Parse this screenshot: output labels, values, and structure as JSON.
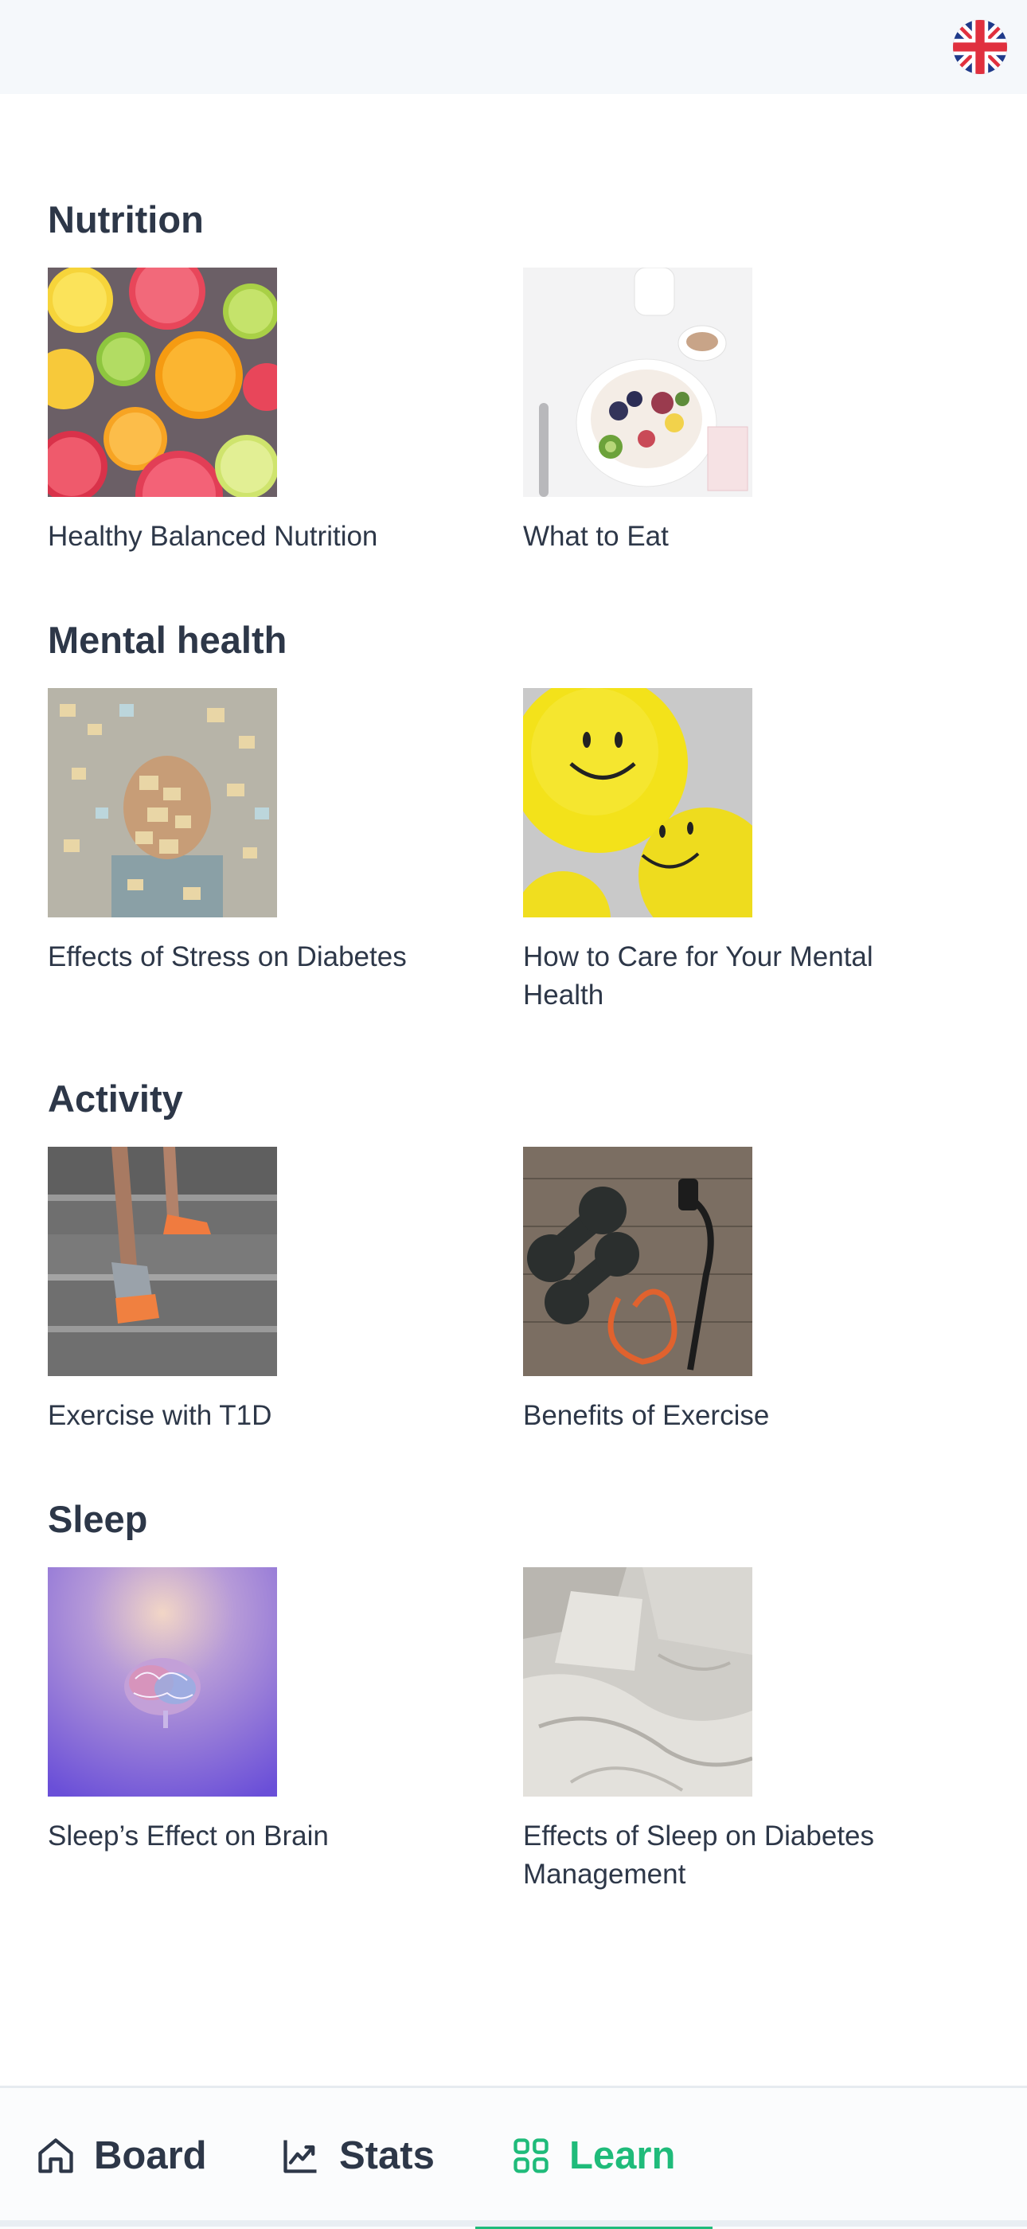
{
  "header": {
    "language_icon": "uk-flag-icon"
  },
  "sections": [
    {
      "title": "Nutrition",
      "items": [
        {
          "label": "Healthy Balanced Nutrition",
          "image": "citrus-slices-image"
        },
        {
          "label": "What to Eat",
          "image": "breakfast-bowl-image"
        }
      ]
    },
    {
      "title": "Mental health",
      "items": [
        {
          "label": "Effects of Stress on Diabetes",
          "image": "sticky-notes-person-image"
        },
        {
          "label": "How to Care for Your Mental Health",
          "image": "smiley-balloons-image"
        }
      ]
    },
    {
      "title": "Activity",
      "items": [
        {
          "label": "Exercise with T1D",
          "image": "running-stairs-image"
        },
        {
          "label": "Benefits of Exercise",
          "image": "dumbbells-image"
        }
      ]
    },
    {
      "title": "Sleep",
      "items": [
        {
          "label": "Sleep’s Effect on Brain",
          "image": "glowing-brain-image"
        },
        {
          "label": "Effects of Sleep on Diabetes Management",
          "image": "bed-sheets-image"
        }
      ]
    }
  ],
  "nav": {
    "board": "Board",
    "stats": "Stats",
    "learn": "Learn",
    "active": "learn",
    "accent_color": "#1fbb7a"
  }
}
